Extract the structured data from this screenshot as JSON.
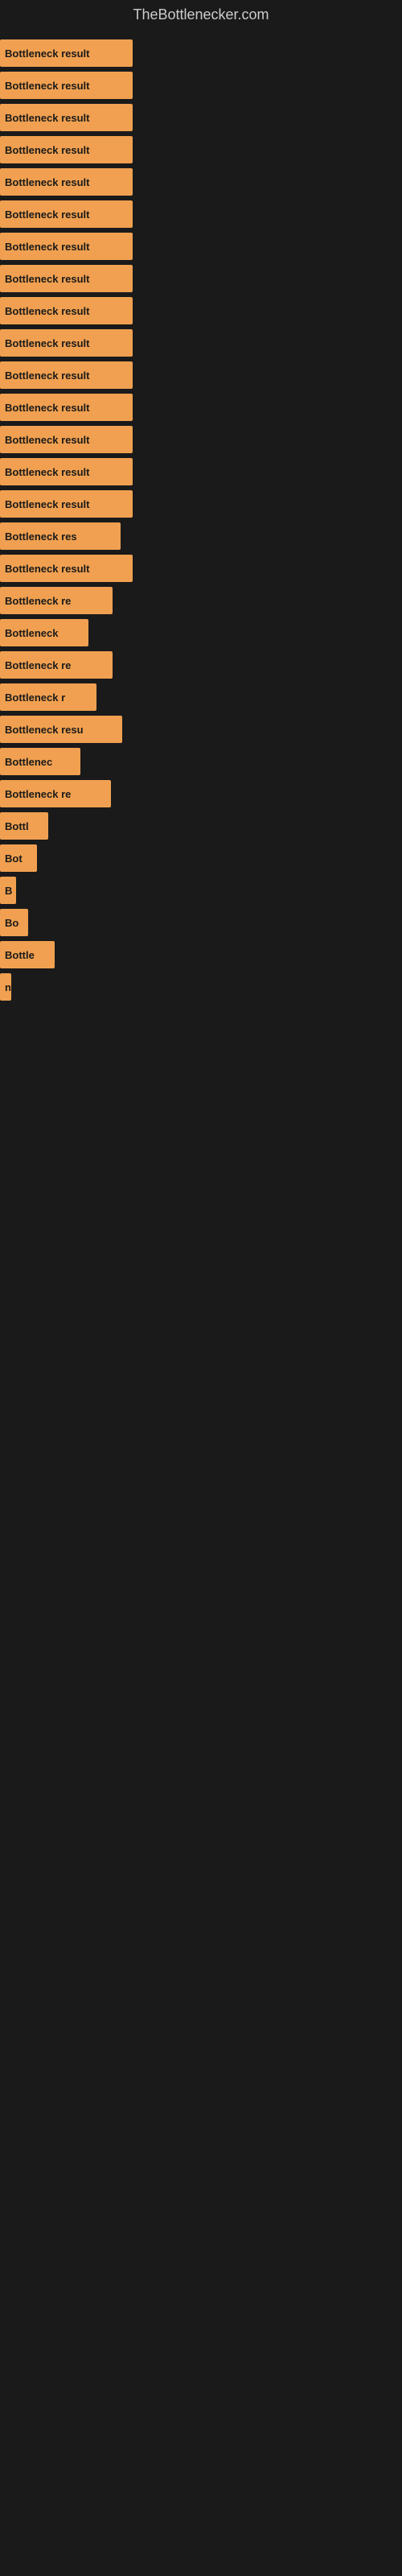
{
  "site": {
    "title": "TheBottlenecker.com"
  },
  "bars": [
    {
      "label": "Bottleneck result",
      "width": 165
    },
    {
      "label": "Bottleneck result",
      "width": 165
    },
    {
      "label": "Bottleneck result",
      "width": 165
    },
    {
      "label": "Bottleneck result",
      "width": 165
    },
    {
      "label": "Bottleneck result",
      "width": 165
    },
    {
      "label": "Bottleneck result",
      "width": 165
    },
    {
      "label": "Bottleneck result",
      "width": 165
    },
    {
      "label": "Bottleneck result",
      "width": 165
    },
    {
      "label": "Bottleneck result",
      "width": 165
    },
    {
      "label": "Bottleneck result",
      "width": 165
    },
    {
      "label": "Bottleneck result",
      "width": 165
    },
    {
      "label": "Bottleneck result",
      "width": 165
    },
    {
      "label": "Bottleneck result",
      "width": 165
    },
    {
      "label": "Bottleneck result",
      "width": 165
    },
    {
      "label": "Bottleneck result",
      "width": 165
    },
    {
      "label": "Bottleneck res",
      "width": 150
    },
    {
      "label": "Bottleneck result",
      "width": 165
    },
    {
      "label": "Bottleneck re",
      "width": 140
    },
    {
      "label": "Bottleneck",
      "width": 110
    },
    {
      "label": "Bottleneck re",
      "width": 140
    },
    {
      "label": "Bottleneck r",
      "width": 120
    },
    {
      "label": "Bottleneck resu",
      "width": 152
    },
    {
      "label": "Bottlenec",
      "width": 100
    },
    {
      "label": "Bottleneck re",
      "width": 138
    },
    {
      "label": "Bottl",
      "width": 60
    },
    {
      "label": "Bot",
      "width": 46
    },
    {
      "label": "B",
      "width": 20
    },
    {
      "label": "Bo",
      "width": 35
    },
    {
      "label": "Bottle",
      "width": 68
    },
    {
      "label": "n",
      "width": 14
    },
    {
      "label": "",
      "width": 0
    },
    {
      "label": "",
      "width": 0
    },
    {
      "label": "",
      "width": 0
    },
    {
      "label": "",
      "width": 0
    },
    {
      "label": "",
      "width": 0
    },
    {
      "label": "",
      "width": 0
    },
    {
      "label": "",
      "width": 0
    },
    {
      "label": "",
      "width": 0
    }
  ]
}
